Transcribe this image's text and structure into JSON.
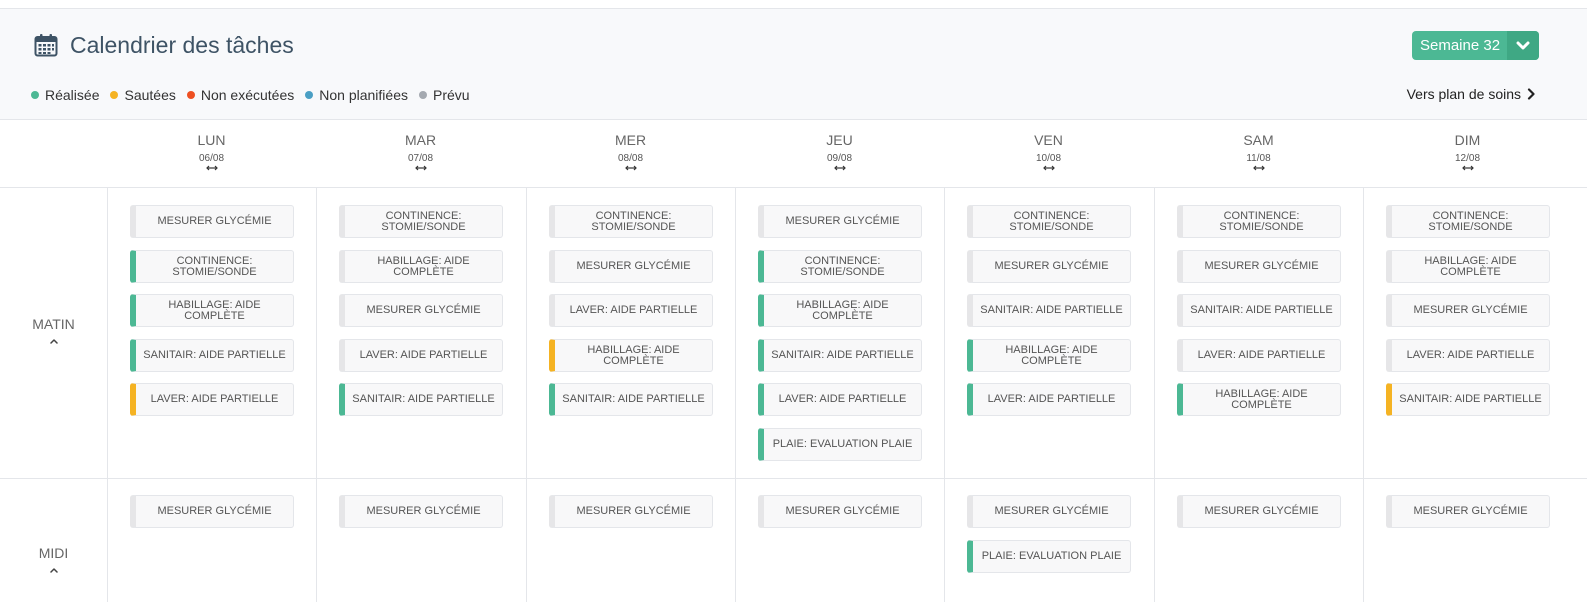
{
  "header": {
    "title": "Calendrier des tâches",
    "icon": "calendar-icon",
    "week_label": "Semaine 32",
    "plan_link": "Vers plan de soins"
  },
  "legend": [
    {
      "label": "Réalisée",
      "color": "#4cb894"
    },
    {
      "label": "Sautées",
      "color": "#f5b323"
    },
    {
      "label": "Non exécutées",
      "color": "#ee5022"
    },
    {
      "label": "Non planifiées",
      "color": "#4a9fc4"
    },
    {
      "label": "Prévu",
      "color": "#a4a9b0"
    }
  ],
  "status_colors": {
    "realisee": "#4cb894",
    "sautee": "#f5b323",
    "prevu": "#e6e6e8"
  },
  "days": [
    {
      "name": "LUN",
      "date": "06/08"
    },
    {
      "name": "MAR",
      "date": "07/08"
    },
    {
      "name": "MER",
      "date": "08/08"
    },
    {
      "name": "JEU",
      "date": "09/08"
    },
    {
      "name": "VEN",
      "date": "10/08"
    },
    {
      "name": "SAM",
      "date": "11/08"
    },
    {
      "name": "DIM",
      "date": "12/08"
    }
  ],
  "periods": [
    {
      "label": "MATIN",
      "columns": [
        [
          {
            "label": "MESURER GLYCÉMIE",
            "status": "prevu"
          },
          {
            "label": "CONTINENCE: STOMIE/SONDE",
            "status": "realisee"
          },
          {
            "label": "HABILLAGE: AIDE COMPLÈTE",
            "status": "realisee"
          },
          {
            "label": "SANITAIR: AIDE PARTIELLE",
            "status": "realisee"
          },
          {
            "label": "LAVER: AIDE PARTIELLE",
            "status": "sautee"
          }
        ],
        [
          {
            "label": "CONTINENCE: STOMIE/SONDE",
            "status": "prevu"
          },
          {
            "label": "HABILLAGE: AIDE COMPLÈTE",
            "status": "prevu"
          },
          {
            "label": "MESURER GLYCÉMIE",
            "status": "prevu"
          },
          {
            "label": "LAVER: AIDE PARTIELLE",
            "status": "prevu"
          },
          {
            "label": "SANITAIR: AIDE PARTIELLE",
            "status": "realisee"
          }
        ],
        [
          {
            "label": "CONTINENCE: STOMIE/SONDE",
            "status": "prevu"
          },
          {
            "label": "MESURER GLYCÉMIE",
            "status": "prevu"
          },
          {
            "label": "LAVER: AIDE PARTIELLE",
            "status": "prevu"
          },
          {
            "label": "HABILLAGE: AIDE COMPLÈTE",
            "status": "sautee"
          },
          {
            "label": "SANITAIR: AIDE PARTIELLE",
            "status": "realisee"
          }
        ],
        [
          {
            "label": "MESURER GLYCÉMIE",
            "status": "prevu"
          },
          {
            "label": "CONTINENCE: STOMIE/SONDE",
            "status": "realisee"
          },
          {
            "label": "HABILLAGE: AIDE COMPLÈTE",
            "status": "realisee"
          },
          {
            "label": "SANITAIR: AIDE PARTIELLE",
            "status": "realisee"
          },
          {
            "label": "LAVER: AIDE PARTIELLE",
            "status": "realisee"
          },
          {
            "label": "PLAIE: EVALUATION PLAIE",
            "status": "realisee"
          }
        ],
        [
          {
            "label": "CONTINENCE: STOMIE/SONDE",
            "status": "prevu"
          },
          {
            "label": "MESURER GLYCÉMIE",
            "status": "prevu"
          },
          {
            "label": "SANITAIR: AIDE PARTIELLE",
            "status": "prevu"
          },
          {
            "label": "HABILLAGE: AIDE COMPLÈTE",
            "status": "realisee"
          },
          {
            "label": "LAVER: AIDE PARTIELLE",
            "status": "realisee"
          }
        ],
        [
          {
            "label": "CONTINENCE: STOMIE/SONDE",
            "status": "prevu"
          },
          {
            "label": "MESURER GLYCÉMIE",
            "status": "prevu"
          },
          {
            "label": "SANITAIR: AIDE PARTIELLE",
            "status": "prevu"
          },
          {
            "label": "LAVER: AIDE PARTIELLE",
            "status": "prevu"
          },
          {
            "label": "HABILLAGE: AIDE COMPLÈTE",
            "status": "realisee"
          }
        ],
        [
          {
            "label": "CONTINENCE: STOMIE/SONDE",
            "status": "prevu"
          },
          {
            "label": "HABILLAGE: AIDE COMPLÈTE",
            "status": "prevu"
          },
          {
            "label": "MESURER GLYCÉMIE",
            "status": "prevu"
          },
          {
            "label": "LAVER: AIDE PARTIELLE",
            "status": "prevu"
          },
          {
            "label": "SANITAIR: AIDE PARTIELLE",
            "status": "sautee"
          }
        ]
      ]
    },
    {
      "label": "MIDI",
      "columns": [
        [
          {
            "label": "MESURER GLYCÉMIE",
            "status": "prevu"
          }
        ],
        [
          {
            "label": "MESURER GLYCÉMIE",
            "status": "prevu"
          }
        ],
        [
          {
            "label": "MESURER GLYCÉMIE",
            "status": "prevu"
          }
        ],
        [
          {
            "label": "MESURER GLYCÉMIE",
            "status": "prevu"
          }
        ],
        [
          {
            "label": "MESURER GLYCÉMIE",
            "status": "prevu"
          },
          {
            "label": "PLAIE: EVALUATION PLAIE",
            "status": "realisee"
          }
        ],
        [
          {
            "label": "MESURER GLYCÉMIE",
            "status": "prevu"
          }
        ],
        [
          {
            "label": "MESURER GLYCÉMIE",
            "status": "prevu"
          }
        ]
      ]
    }
  ]
}
